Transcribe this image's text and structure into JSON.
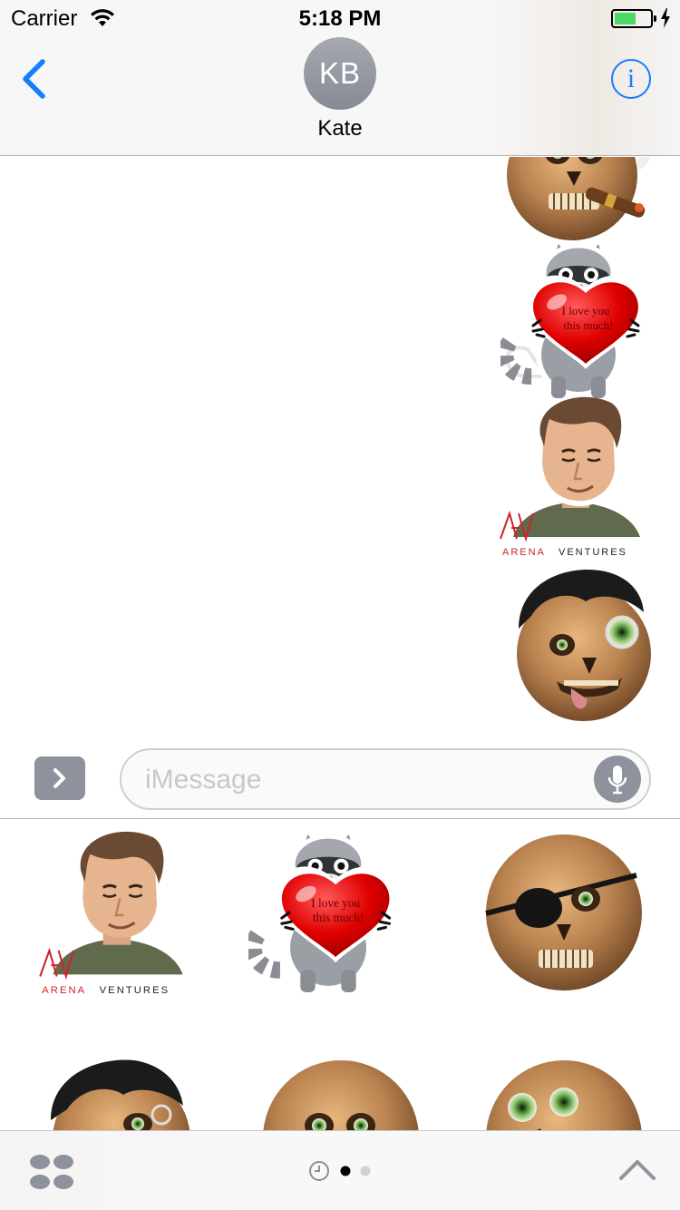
{
  "status_bar": {
    "carrier": "Carrier",
    "time": "5:18 PM",
    "battery_level": 0.6
  },
  "nav": {
    "back_icon": "chevron-left-icon",
    "avatar_initials": "KB",
    "contact_name": "Kate",
    "info_icon": "info-icon",
    "info_glyph": "i"
  },
  "messages": [
    {
      "sticker": "skull-with-cigar"
    },
    {
      "sticker": "raccoon-heart",
      "text_line1": "I love you",
      "text_line2": "this much!"
    },
    {
      "sticker": "man-portrait-arena-ventures",
      "logo_mark": "AV",
      "logo_text_red": "ARENA",
      "logo_text_dark": "VENTURES"
    },
    {
      "sticker": "skull-with-tongue"
    }
  ],
  "composer": {
    "placeholder": "iMessage",
    "apps_toggle_icon": "chevron-right-icon",
    "mic_icon": "microphone-icon"
  },
  "sticker_drawer": [
    {
      "sticker": "man-portrait-arena-ventures",
      "logo_mark": "AV",
      "logo_text_red": "ARENA",
      "logo_text_dark": "VENTURES"
    },
    {
      "sticker": "raccoon-heart",
      "text_line1": "I love you",
      "text_line2": "this much!"
    },
    {
      "sticker": "skull-eyepatch"
    },
    {
      "sticker": "skull-black-hair"
    },
    {
      "sticker": "skull-bulging-eyes"
    },
    {
      "sticker": "skull-wide-eyes"
    }
  ],
  "bottom_bar": {
    "app_grid_icon": "app-drawer-icon",
    "recents_icon": "clock-icon",
    "page_count": 2,
    "active_page": 1,
    "collapse_icon": "chevron-up-icon"
  },
  "colors": {
    "ios_blue": "#147efb",
    "avatar_gray": "#8e929c",
    "heart_red": "#e00000",
    "arena_red": "#d0232a"
  }
}
